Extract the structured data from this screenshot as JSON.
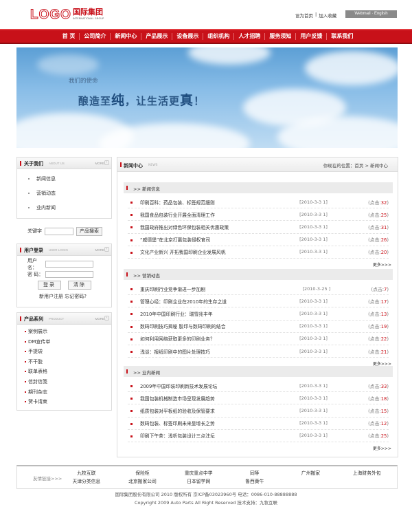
{
  "header": {
    "logo_en": "LOGO",
    "logo_cn": "国际集团",
    "logo_sub": "INTERNATIONAL GROUP",
    "set_home": "设为首页",
    "sep": "|",
    "add_fav": "加入收藏",
    "webmail": "Webmail",
    "lang_sep": "·",
    "english": "English"
  },
  "nav": [
    "首 页",
    "公司简介",
    "新闻中心",
    "产品展示",
    "设备展示",
    "组织机构",
    "人才招聘",
    "服务须知",
    "用户反馈",
    "联系我们"
  ],
  "banner": {
    "sub": "我们的使命",
    "pre": "酿造至",
    "em1": "纯",
    "mid": "，让生活更",
    "em2": "真",
    "end": "！"
  },
  "about": {
    "title": "关于我们",
    "en": "ABOUT US",
    "more": "MORE",
    "items": [
      "新闻信息",
      "营销动态",
      "业内新闻"
    ]
  },
  "search": {
    "label": "关键字",
    "button": "产品搜索"
  },
  "login": {
    "title": "用户登录",
    "en": "USER LOGIN",
    "more": "MORE",
    "user_label": "用户名：",
    "pass_label": "密 码：",
    "login_btn": "登录",
    "clear_btn": "清除",
    "register": "新用户注册",
    "forgot": "忘记密码?"
  },
  "products": {
    "title": "产品系列",
    "en": "PRODUCT",
    "more": "MORE",
    "items": [
      "案例展示",
      "DM宣传单",
      "手提袋",
      "不干胶",
      "联单表格",
      "信封信笺",
      "期刊杂志",
      "贺卡请柬"
    ]
  },
  "main": {
    "title": "新闻中心",
    "en": "NEWS",
    "breadcrumb_pre": "你现在的位置：",
    "breadcrumb_home": "首页",
    "breadcrumb_rest": " > 新闻中心"
  },
  "sections": [
    {
      "title": ">> 新闻信息",
      "more": "更多>>>",
      "items": [
        {
          "title": "印刷百科：药品包装、标签规范细则",
          "date": "[2010-3-3 1]",
          "hits_pre": "(点击:",
          "hits": "32",
          "hits_post": ")"
        },
        {
          "title": "我国食品包装行业开展全面清理工作",
          "date": "[2010-3-3 1]",
          "hits_pre": "(点击:",
          "hits": "25",
          "hits_post": ")"
        },
        {
          "title": "我国政府推出对绿色环保包装相关优惠政策",
          "date": "[2010-3-3 1]",
          "hits_pre": "(点击:",
          "hits": "31",
          "hits_post": ")"
        },
        {
          "title": "“威德堡”在北京打赢包装侵权官司",
          "date": "[2010-3-3 1]",
          "hits_pre": "(点击:",
          "hits": "26",
          "hits_post": ")"
        },
        {
          "title": "文化产业新兴 开拓我国印刷企业发展风帆",
          "date": "[2010-3-3 1]",
          "hits_pre": "(点击:",
          "hits": "20",
          "hits_post": ")"
        }
      ]
    },
    {
      "title": ">> 营销动态",
      "more": "更多>>>",
      "items": [
        {
          "title": "重庆印刷行业竞争渐进一步加剧",
          "date": "[2010-3-25 ]",
          "hits_pre": "(点击:",
          "hits": "7",
          "hits_post": ")"
        },
        {
          "title": "管理心经：印刷企业在2010年的生存之道",
          "date": "[2010-3-3 1]",
          "hits_pre": "(点击:",
          "hits": "17",
          "hits_post": ")"
        },
        {
          "title": "2010年中国印刷行业：瑞雪兆丰年",
          "date": "[2010-3-3 1]",
          "hits_pre": "(点击:",
          "hits": "13",
          "hits_post": ")"
        },
        {
          "title": "数码印刷技巧揭秘 胶印与数码印刷的结合",
          "date": "[2010-3-3 1]",
          "hits_pre": "(点击:",
          "hits": "19",
          "hits_post": ")"
        },
        {
          "title": "如何利用网络获取更多的印刷业务？",
          "date": "[2010-3-3 1]",
          "hits_pre": "(点击:",
          "hits": "22",
          "hits_post": ")"
        },
        {
          "title": "浅谈：报纸印刷中的图片处理技巧",
          "date": "[2010-3-3 1]",
          "hits_pre": "(点击:",
          "hits": "21",
          "hits_post": ")"
        }
      ]
    },
    {
      "title": ">> 业内新闻",
      "more": "更多>>>",
      "items": [
        {
          "title": "2009年中国印装印刷新技术发展论坛",
          "date": "[2010-3-3 1]",
          "hits_pre": "(点击:",
          "hits": "33",
          "hits_post": ")"
        },
        {
          "title": "我国包装机械制造市场呈现发展趋势",
          "date": "[2010-3-3 1]",
          "hits_pre": "(点击:",
          "hits": "18",
          "hits_post": ")"
        },
        {
          "title": "纸质包装对平板纸的验收及保管要求",
          "date": "[2010-3-3 1]",
          "hits_pre": "(点击:",
          "hits": "15",
          "hits_post": ")"
        },
        {
          "title": "数码包装、标签印刷未来呈增长之势",
          "date": "[2010-3-3 1]",
          "hits_pre": "(点击:",
          "hits": "12",
          "hits_post": ")"
        },
        {
          "title": "印刷下午茶：浅析包装设计三点注坛",
          "date": "[2010-3-3 1]",
          "hits_pre": "(点击:",
          "hits": "25",
          "hits_post": ")"
        }
      ]
    }
  ],
  "friends": {
    "label": "友情链接>>>",
    "links": [
      "九牧互联",
      "保险柜",
      "重庆重点中学",
      "同等",
      "广州搬家",
      "上海财务外包",
      "天津分类信息",
      "北京搬家公司",
      "日本留学网",
      "鲁西黄牛",
      "",
      ""
    ]
  },
  "footer": {
    "line1": "国际集团股份有限公司  2010 版权所有  京ICP备03023960号  电话：0086-010-88888888",
    "line2": "Copyright 2009 Auto Parts All Right Reserved 技术支持：九牧互联"
  },
  "colors": {
    "accent": "#c81119"
  }
}
